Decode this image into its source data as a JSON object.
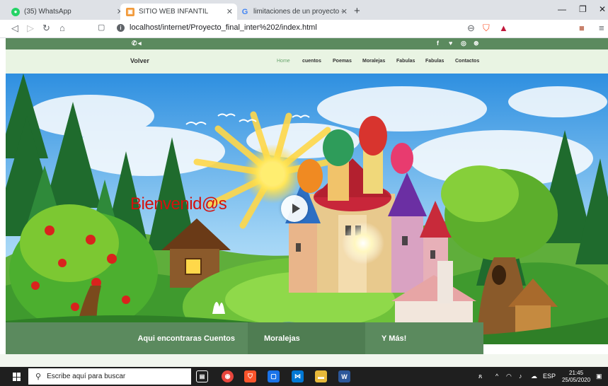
{
  "browser": {
    "tabs": [
      {
        "label": "(35) WhatsApp",
        "favicon": "whatsapp-icon"
      },
      {
        "label": "SITIO WEB INFANTIL",
        "favicon": "site-icon"
      },
      {
        "label": "limitaciones de un proyecto - Busc",
        "favicon": "google-icon"
      }
    ],
    "new_tab": "+",
    "url": "localhost/internet/Proyecto_final_inter%202/index.html"
  },
  "site": {
    "brand": "Volver",
    "nav": [
      {
        "label": "Home",
        "active": true
      },
      {
        "label": "cuentos"
      },
      {
        "label": "Poemas"
      },
      {
        "label": "Moralejas"
      },
      {
        "label": "Fabulas"
      },
      {
        "label": "Fabulas"
      },
      {
        "label": "Contactos"
      }
    ],
    "social_icons": [
      "facebook-icon",
      "twitter-icon",
      "instagram-icon",
      "dribbble-icon"
    ],
    "hero_title": "Bienvenid@s",
    "features": [
      "Aqui encontraras Cuentos",
      "Moralejas",
      "Y Más!"
    ],
    "colors": {
      "primary_green": "#5b8a5e",
      "nav_bg": "#e9f4e3",
      "title_red": "#d4110e",
      "active_link": "#6aa56f"
    }
  },
  "taskbar": {
    "search_placeholder": "Escribe aquí para buscar",
    "language": "ESP",
    "time": "21:45",
    "date": "25/05/2020"
  }
}
